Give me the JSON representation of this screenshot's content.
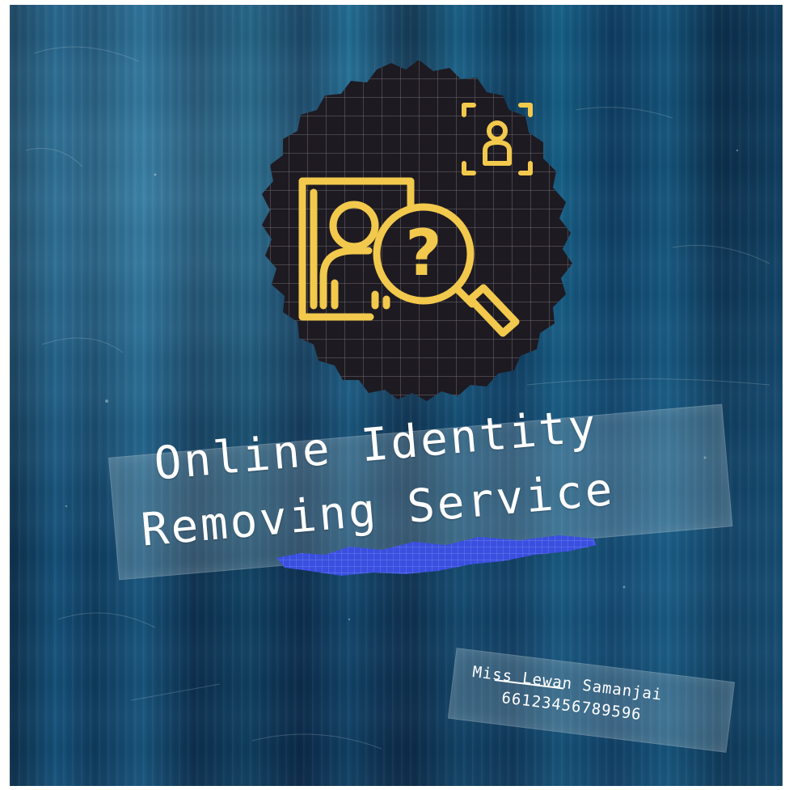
{
  "title": {
    "line1": "Online Identity",
    "line2": "Removing Service"
  },
  "author": {
    "name": "Miss Lewan Samanjai",
    "id": "66123456789596"
  },
  "icons": [
    "identity-search-icon",
    "face-scan-icon"
  ],
  "colors": {
    "background": "#15517a",
    "badge": "#1e1a22",
    "icon_yellow": "#f2c94c",
    "highlight": "#3a4fe0",
    "text": "#ffffff"
  }
}
